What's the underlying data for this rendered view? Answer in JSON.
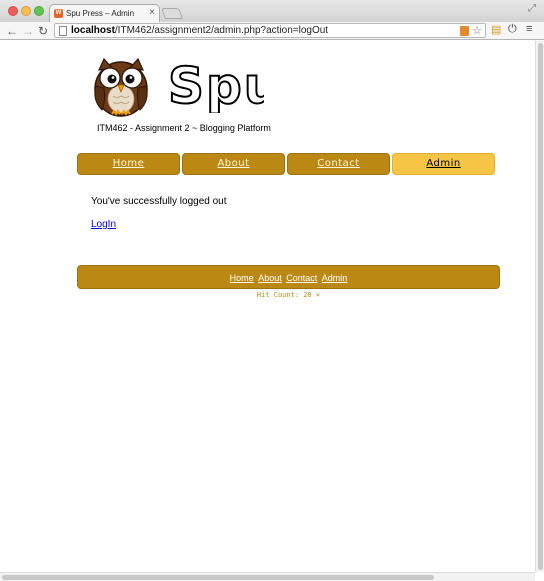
{
  "browser": {
    "tab_title": "Spu Press – Admin",
    "tab_favicon_letter": "W",
    "url_host": "localhost",
    "url_path": "/ITM462/assignment2/admin.php?action=logOut"
  },
  "site": {
    "logo_text": "Spu",
    "subtitle": "ITM462 - Assignment 2 ~ Blogging Platform"
  },
  "nav": {
    "items": [
      {
        "label": "Home",
        "active": false
      },
      {
        "label": "About",
        "active": false
      },
      {
        "label": "Contact",
        "active": false
      },
      {
        "label": "Admin",
        "active": true
      }
    ]
  },
  "main": {
    "message": "You've successfully logged out",
    "login_link": "LogIn"
  },
  "footer": {
    "links": [
      "Home",
      "About",
      "Contact",
      "Admin"
    ],
    "hit_count": "Hit Count:  20 ×"
  },
  "colors": {
    "accent": "#bb8913",
    "accent_active": "#f6c545"
  }
}
